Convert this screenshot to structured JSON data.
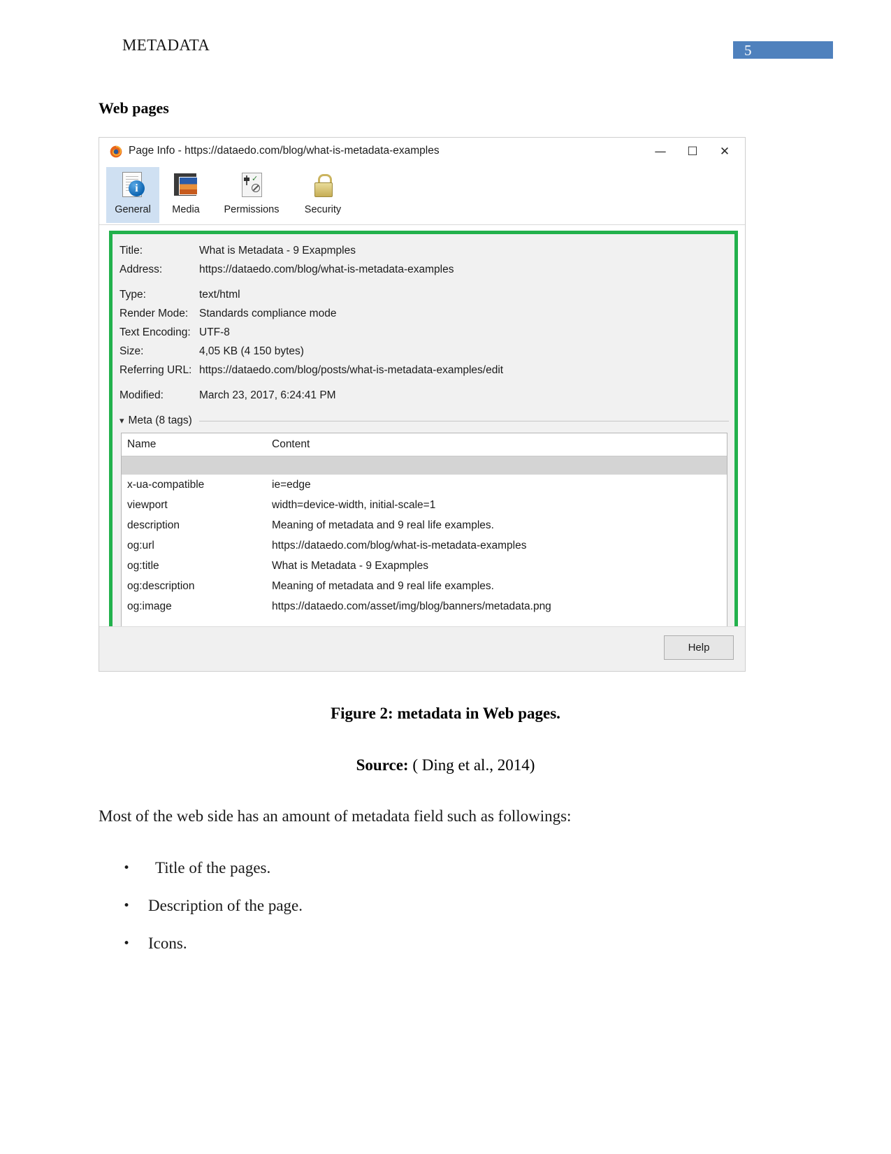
{
  "document": {
    "header_title": "METADATA",
    "page_number": "5",
    "accent_color": "#4f81bd",
    "section_heading": "Web pages",
    "figure_caption": "Figure 2: metadata in Web pages.",
    "source_label": "Source:",
    "source_citation": "( Ding et al., 2014)",
    "paragraph": "Most of the web side has an amount of metadata field such as followings:",
    "bullets": [
      {
        "marker": "•",
        "text": "Title of the pages."
      },
      {
        "marker": "•",
        "text": "Description of the page."
      },
      {
        "marker": "•",
        "text": "Icons."
      }
    ]
  },
  "page_info_window": {
    "titlebar": {
      "app_icon": "firefox-icon",
      "title": "Page Info - https://dataedo.com/blog/what-is-metadata-examples",
      "minimize": "—",
      "maximize": "☐",
      "close": "✕"
    },
    "tabs": [
      {
        "label": "General",
        "icon": "general-info-icon",
        "selected": true
      },
      {
        "label": "Media",
        "icon": "media-filmstrip-icon",
        "selected": false
      },
      {
        "label": "Permissions",
        "icon": "permissions-sliders-icon",
        "selected": false
      },
      {
        "label": "Security",
        "icon": "security-padlock-icon",
        "selected": false
      }
    ],
    "general": {
      "highlight_color": "#22b14c",
      "fields_group_one": [
        {
          "label": "Title:",
          "value": "What is Metadata - 9 Exapmples"
        },
        {
          "label": "Address:",
          "value": "https://dataedo.com/blog/what-is-metadata-examples"
        }
      ],
      "fields_group_two": [
        {
          "label": "Type:",
          "value": "text/html"
        },
        {
          "label": "Render Mode:",
          "value": "Standards compliance mode"
        },
        {
          "label": "Text Encoding:",
          "value": "UTF-8"
        },
        {
          "label": "Size:",
          "value": "4,05 KB (4 150 bytes)"
        },
        {
          "label": "Referring URL:",
          "value": "https://dataedo.com/blog/posts/what-is-metadata-examples/edit"
        }
      ],
      "fields_group_three": [
        {
          "label": "Modified:",
          "value": "March 23, 2017, 6:24:41 PM"
        }
      ],
      "meta_section": {
        "toggle_icon": "chevron-down-icon",
        "title": "Meta (8 tags)",
        "columns": [
          "Name",
          "Content"
        ],
        "rows": [
          {
            "name": "x-ua-compatible",
            "content": "ie=edge"
          },
          {
            "name": "viewport",
            "content": "width=device-width, initial-scale=1"
          },
          {
            "name": "description",
            "content": "Meaning of metadata and 9 real life examples."
          },
          {
            "name": "og:url",
            "content": "https://dataedo.com/blog/what-is-metadata-examples"
          },
          {
            "name": "og:title",
            "content": "What is Metadata - 9 Exapmples"
          },
          {
            "name": "og:description",
            "content": "Meaning of metadata and 9 real life examples."
          },
          {
            "name": "og:image",
            "content": "https://dataedo.com/asset/img/blog/banners/metadata.png"
          }
        ]
      }
    },
    "footer": {
      "help_label": "Help"
    }
  }
}
